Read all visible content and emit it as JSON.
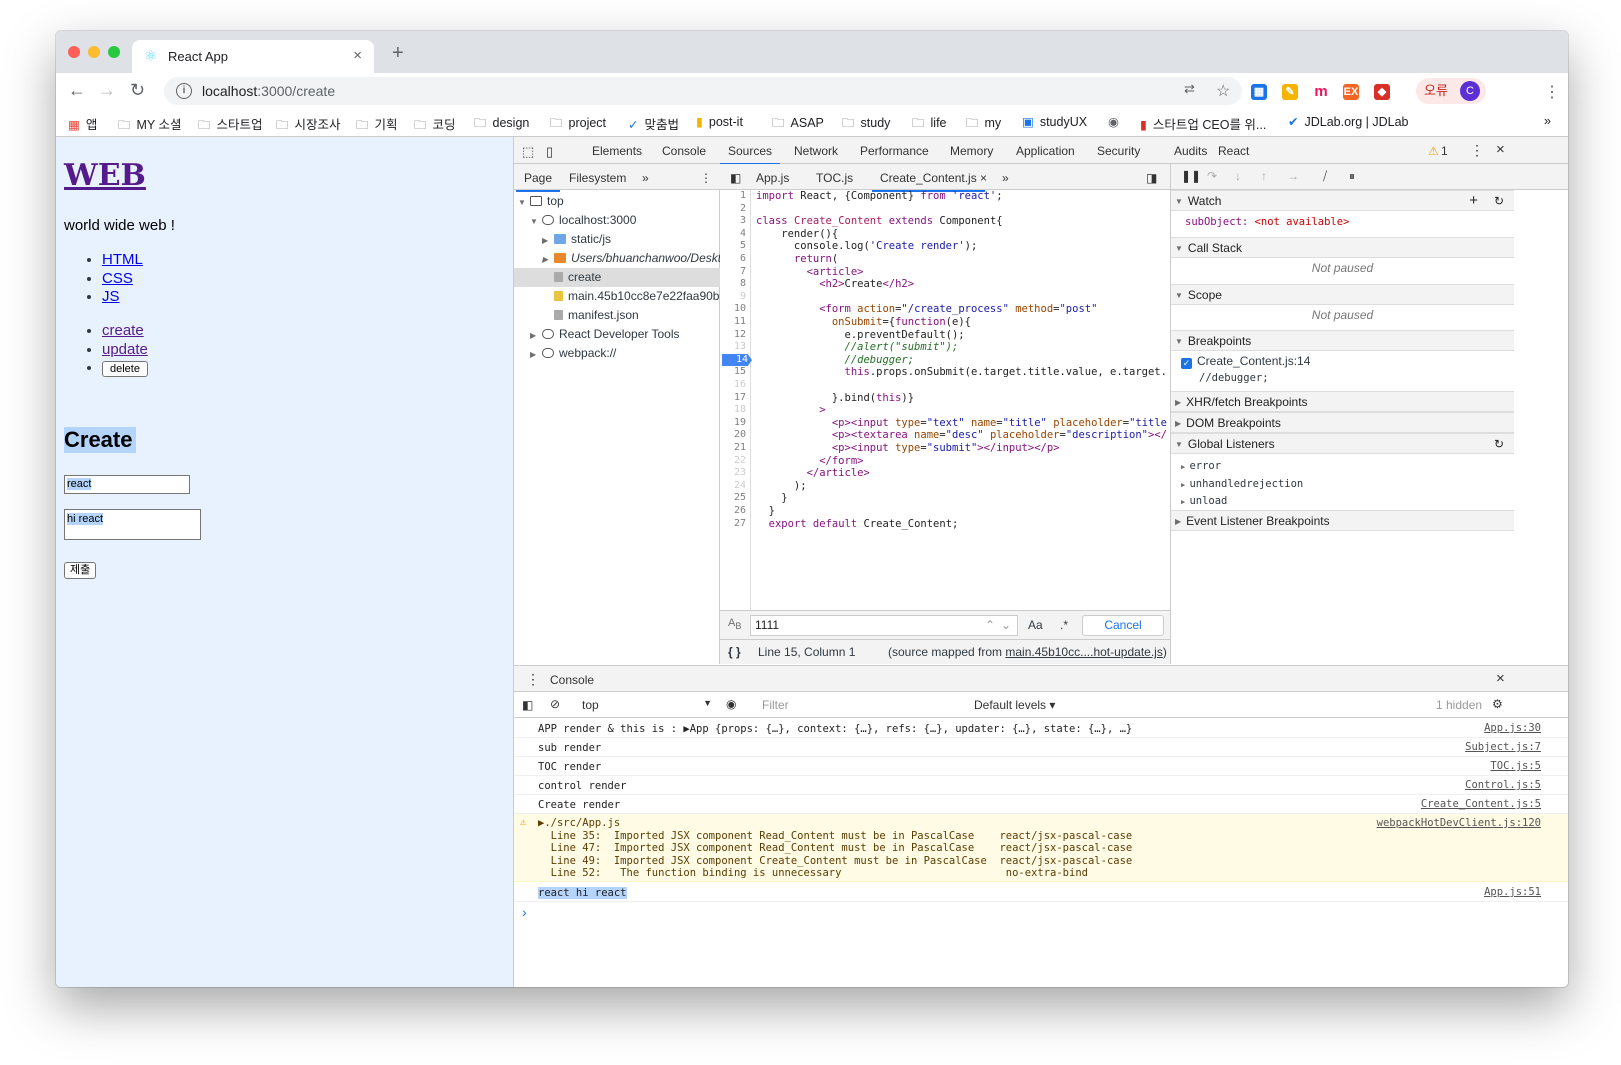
{
  "browser": {
    "tab_title": "React App",
    "url_host": "localhost",
    "url_rest": ":3000/create",
    "error_label": "오류",
    "avatar_letter": "C",
    "bookmarks": [
      "앱",
      "MY 소셜",
      "스타트업",
      "시장조사",
      "기획",
      "코딩",
      "design",
      "project",
      "맞춤법",
      "post-it",
      "ASAP",
      "study",
      "life",
      "my",
      "studyUX",
      "",
      "스타트업 CEO를 위...",
      "JDLab.org | JDLab"
    ],
    "bookmarks_more": "»"
  },
  "page": {
    "title": "WEB",
    "tagline": "world wide web !",
    "toc": [
      "HTML",
      "CSS",
      "JS"
    ],
    "controls": [
      "create",
      "update"
    ],
    "delete_label": "delete",
    "heading": "Create",
    "title_value": "react",
    "desc_value": "hi react",
    "submit_label": "제출"
  },
  "devtools": {
    "tabs": [
      "Elements",
      "Console",
      "Sources",
      "Network",
      "Performance",
      "Memory",
      "Application",
      "Security",
      "Audits",
      "React"
    ],
    "selected_tab": "Sources",
    "warning_count": "1",
    "navigator_tabs": [
      "Page",
      "Filesystem"
    ],
    "tree": [
      {
        "label": "top",
        "depth": 0,
        "arrow": "▼",
        "icon": "frame"
      },
      {
        "label": "localhost:3000",
        "depth": 1,
        "arrow": "▼",
        "icon": "cloud"
      },
      {
        "label": "static/js",
        "depth": 2,
        "arrow": "▶",
        "icon": "folder-blue"
      },
      {
        "label": "Users/bhuanchanwoo/Deskt",
        "depth": 2,
        "arrow": "▶",
        "icon": "folder-orange"
      },
      {
        "label": "create",
        "depth": 2,
        "arrow": "",
        "icon": "file-gray",
        "selected": true
      },
      {
        "label": "main.45b10cc8e7e22faa90b",
        "depth": 2,
        "arrow": "",
        "icon": "file-yellow"
      },
      {
        "label": "manifest.json",
        "depth": 2,
        "arrow": "",
        "icon": "file-gray"
      },
      {
        "label": "React Developer Tools",
        "depth": 1,
        "arrow": "▶",
        "icon": "cloud"
      },
      {
        "label": "webpack://",
        "depth": 1,
        "arrow": "▶",
        "icon": "cloud"
      }
    ],
    "editor_tabs": [
      "App.js",
      "TOC.js",
      "Create_Content.js"
    ],
    "active_editor_tab": "Create_Content.js",
    "line_numbers": [
      "1",
      "2",
      "3",
      "4",
      "5",
      "6",
      "7",
      "8",
      "9",
      "10",
      "11",
      "12",
      "13",
      "14",
      "15",
      "16",
      "17",
      "18",
      "19",
      "20",
      "21",
      "22",
      "23",
      "24",
      "25",
      "26",
      "27"
    ],
    "breakpoint_line": "14",
    "search_value": "1111",
    "search_match_case": "Aa",
    "search_regex": ".*",
    "cancel_label": "Cancel",
    "status_position": "Line 15, Column 1",
    "status_source_prefix": "(source mapped from ",
    "status_source_link": "main.45b10cc....hot-update.js",
    "status_source_suffix": ")",
    "sidebar": {
      "watch": "Watch",
      "watch_item_name": "subObject:",
      "watch_item_value": "<not available>",
      "call_stack": "Call Stack",
      "not_paused": "Not paused",
      "scope": "Scope",
      "breakpoints": "Breakpoints",
      "bp_file": "Create_Content.js:14",
      "bp_code": "//debugger;",
      "xhr": "XHR/fetch Breakpoints",
      "dom": "DOM Breakpoints",
      "global": "Global Listeners",
      "listeners": [
        "error",
        "unhandledrejection",
        "unload"
      ],
      "event": "Event Listener Breakpoints"
    },
    "console": {
      "drawer_tab": "Console",
      "context": "top",
      "filter_placeholder": "Filter",
      "levels": "Default levels ▾",
      "hidden": "1 hidden",
      "messages": [
        {
          "text": "APP render & this is :  ▶App {props: {…}, context: {…}, refs: {…}, updater: {…}, state: {…}, …}",
          "src": "App.js:30"
        },
        {
          "text": "sub render",
          "src": "Subject.js:7"
        },
        {
          "text": "TOC render",
          "src": "TOC.js:5"
        },
        {
          "text": "control render",
          "src": "Control.js:5"
        },
        {
          "text": "Create render",
          "src": "Create_Content.js:5"
        }
      ],
      "warning_head": "▶./src/App.js",
      "warning_src": "webpackHotDevClient.js:120",
      "warning_lines": [
        "  Line 35:  Imported JSX component Read_Content must be in PascalCase    react/jsx-pascal-case",
        "  Line 47:  Imported JSX component Read_Content must be in PascalCase    react/jsx-pascal-case",
        "  Line 49:  Imported JSX component Create_Content must be in PascalCase  react/jsx-pascal-case",
        "  Line 52:   The function binding is unnecessary                          no-extra-bind"
      ],
      "last_text": "react hi react",
      "last_src": "App.js:51",
      "prompt": "›"
    }
  },
  "colors": {
    "accent": "#1a73e8",
    "link": "#0000ee",
    "visited": "#551a8b",
    "selection": "#b4d4fb",
    "page_bg": "#e8f2fe"
  }
}
